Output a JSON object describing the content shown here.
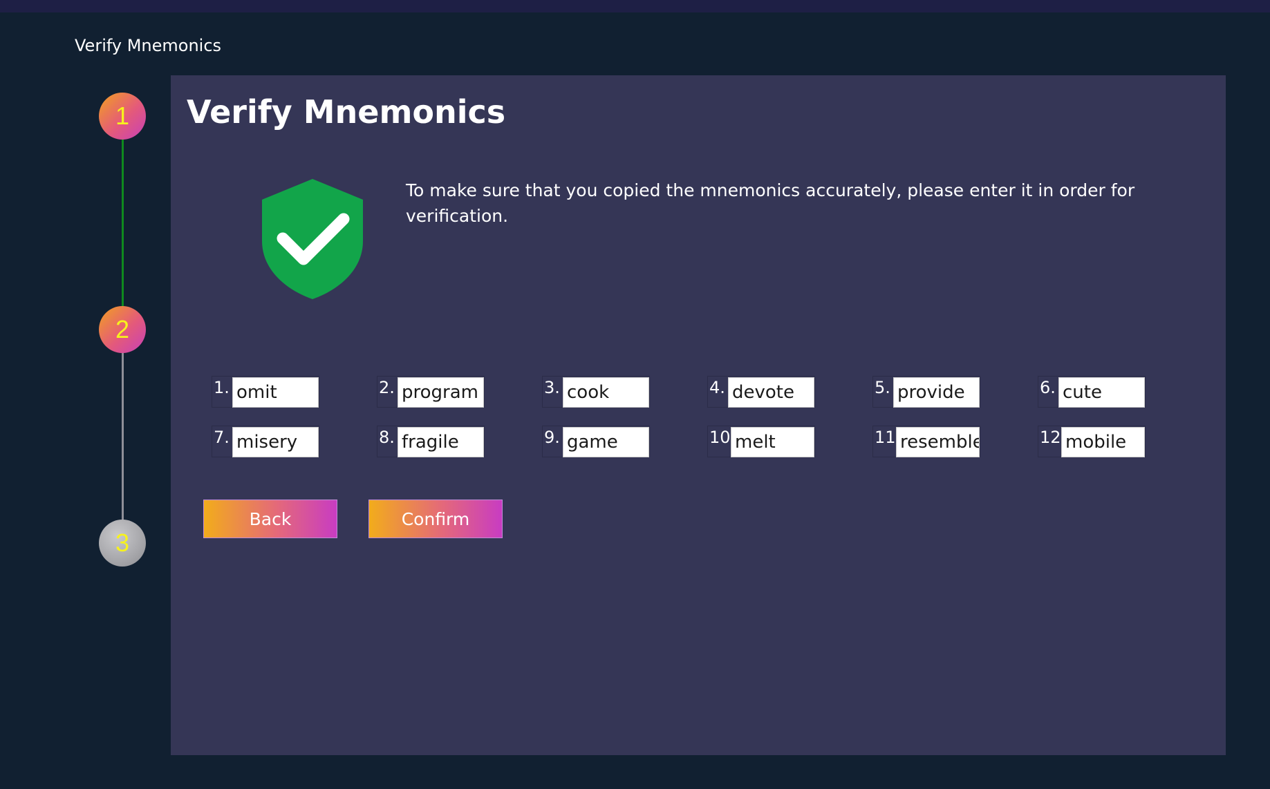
{
  "window": {
    "title": "Verify Mnemonics"
  },
  "stepper": {
    "steps": [
      {
        "label": "1",
        "state": "completed"
      },
      {
        "label": "2",
        "state": "current"
      },
      {
        "label": "3",
        "state": "pending"
      }
    ],
    "colors": {
      "completed_line": "#0f8a1e",
      "pending_line": "#8f8f98",
      "number": "#f7f21d"
    }
  },
  "panel": {
    "title": "Verify Mnemonics",
    "icon": "shield-check-icon",
    "instructions": "To make sure that you copied the mnemonics accurately, please enter it in order for verification."
  },
  "words": [
    {
      "number": "1.",
      "value": "omit"
    },
    {
      "number": "2.",
      "value": "program"
    },
    {
      "number": "3.",
      "value": "cook"
    },
    {
      "number": "4.",
      "value": "devote"
    },
    {
      "number": "5.",
      "value": "provide"
    },
    {
      "number": "6.",
      "value": "cute"
    },
    {
      "number": "7.",
      "value": "misery"
    },
    {
      "number": "8.",
      "value": "fragile"
    },
    {
      "number": "9.",
      "value": "game"
    },
    {
      "number": "10",
      "value": "melt"
    },
    {
      "number": "11",
      "value": "resemble"
    },
    {
      "number": "12",
      "value": "mobile"
    }
  ],
  "buttons": {
    "back": "Back",
    "confirm": "Confirm"
  },
  "colors": {
    "background": "#112031",
    "panel": "#353656",
    "accent_gradient_start": "#f2ac1b",
    "accent_gradient_end": "#c83cc2",
    "shield": "#12a54a"
  }
}
